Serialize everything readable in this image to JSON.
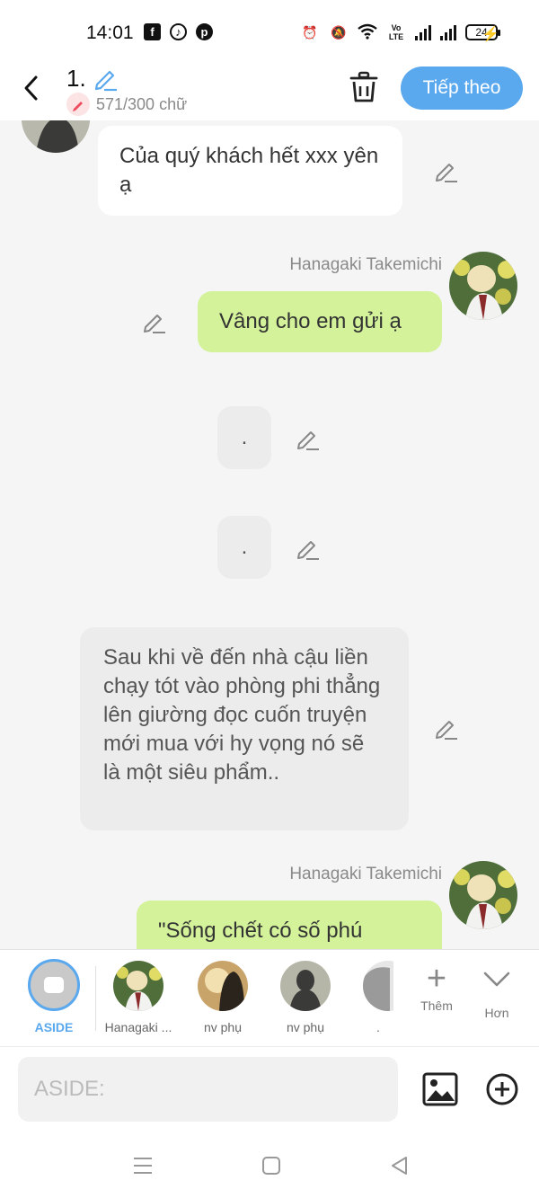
{
  "status_bar": {
    "time": "14:01",
    "left_icons": [
      "facebook-icon",
      "tiktok-icon",
      "pinterest-icon"
    ],
    "right_icons": [
      "alarm-icon",
      "mute-icon",
      "wifi-icon",
      "volte-icon",
      "signal-icon",
      "signal-icon"
    ],
    "volte_label": "Vo LTE",
    "battery": "24"
  },
  "header": {
    "chapter": "1.",
    "word_count": "571/300 chữ",
    "next_label": "Tiếp theo"
  },
  "messages": [
    {
      "type": "incoming",
      "text": "Của quý khách hết xxx yên ạ"
    },
    {
      "type": "outgoing",
      "name": "Hanagaki Takemichi",
      "text": "Vâng cho em gửi ạ"
    },
    {
      "type": "aside",
      "text": "."
    },
    {
      "type": "aside",
      "text": "."
    },
    {
      "type": "aside",
      "text": "Sau khi về đến nhà cậu liền chạy tót vào phòng phi thẳng lên giường đọc cuốn truyện mới mua với hy vọng nó sẽ là một siêu phẩm.."
    },
    {
      "type": "outgoing",
      "name": "Hanagaki Takemichi",
      "text": "\"Sống chết có số phú"
    }
  ],
  "characters": [
    {
      "label": "ASIDE",
      "selected": true
    },
    {
      "label": "Hanagaki ..."
    },
    {
      "label": "nv phụ"
    },
    {
      "label": "nv phụ"
    },
    {
      "label": "."
    }
  ],
  "char_actions": {
    "add_label": "Thêm",
    "more_label": "Hơn"
  },
  "input": {
    "placeholder": "ASIDE:",
    "value": ""
  },
  "colors": {
    "accent": "#5aa8ee",
    "outgoing_bubble": "#d3f29a",
    "aside_bubble": "#ececec",
    "background": "#f5f5f5"
  }
}
